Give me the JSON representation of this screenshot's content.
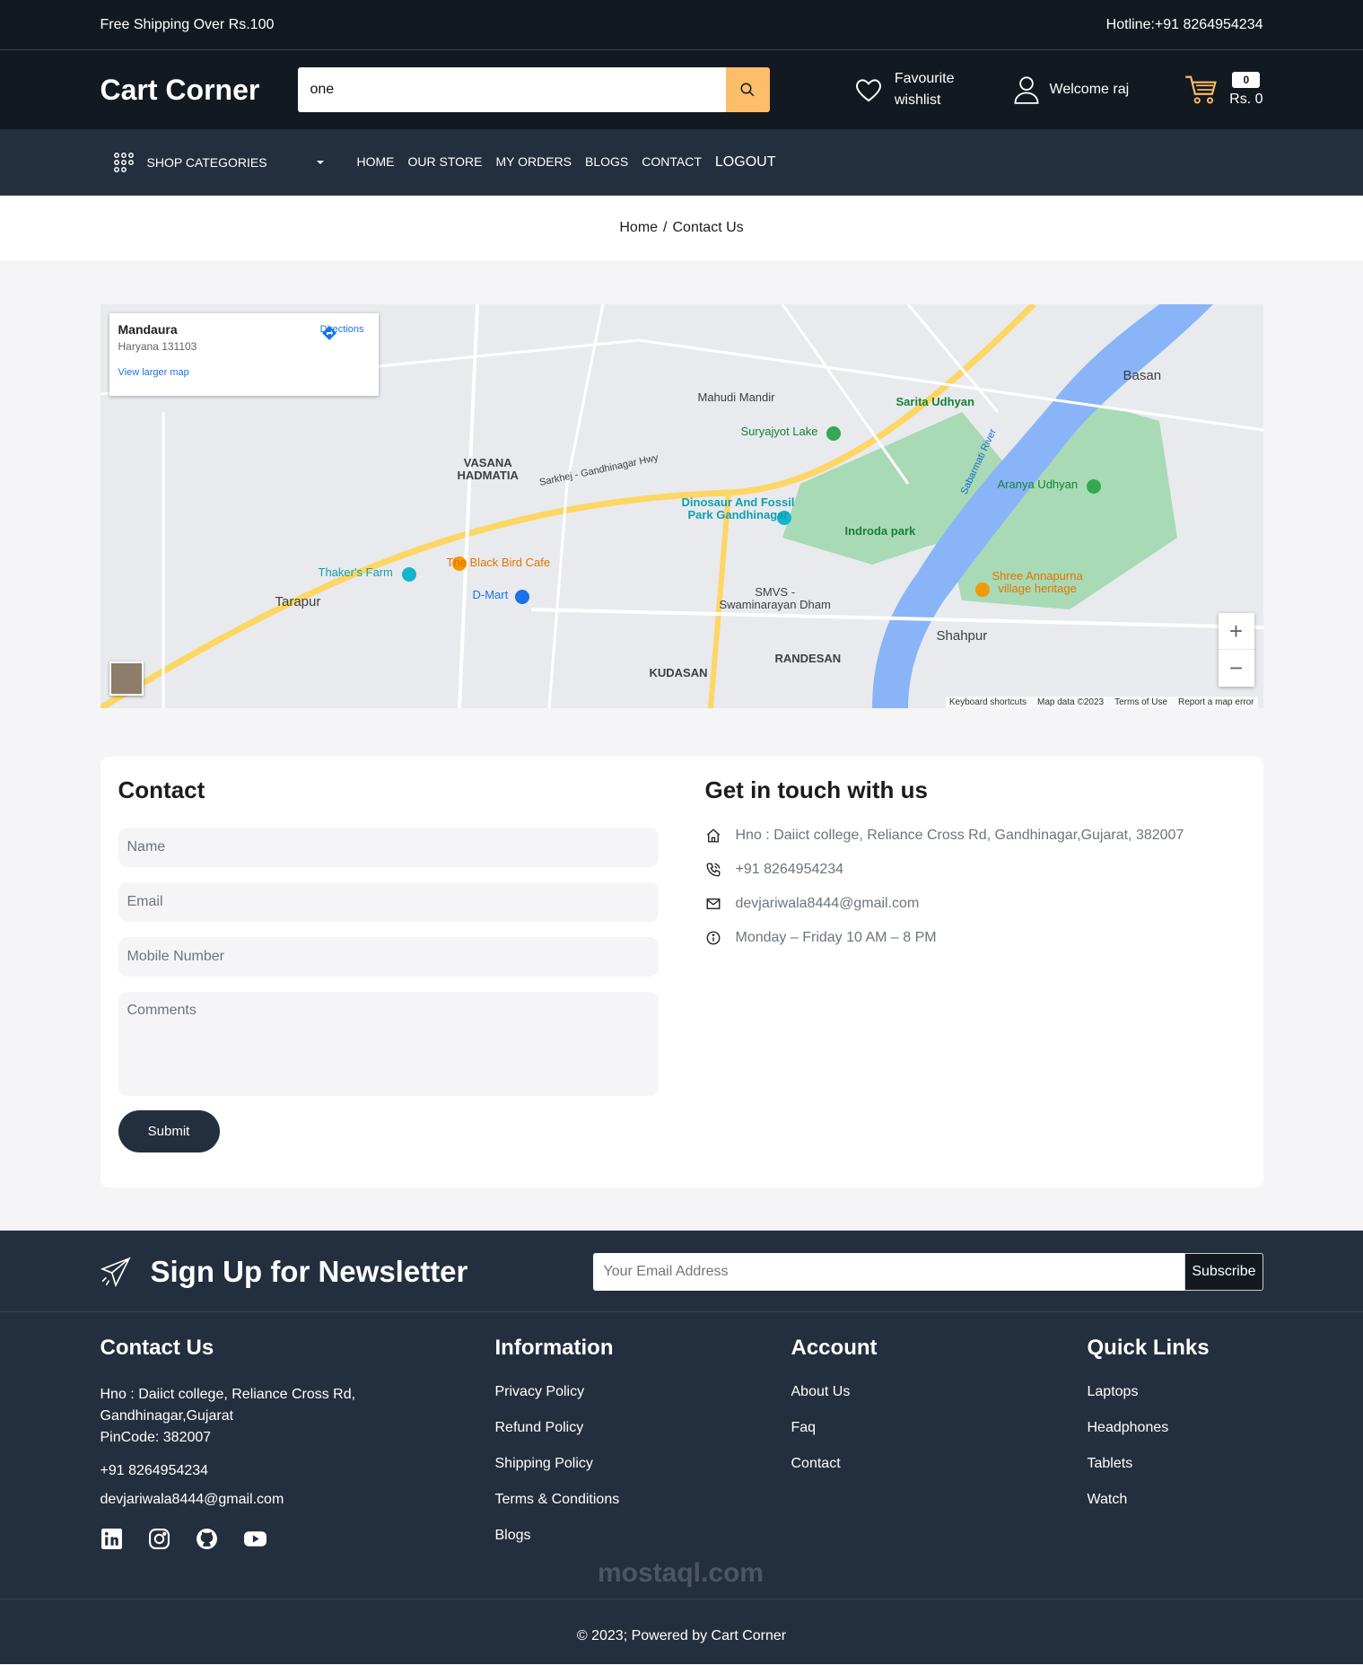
{
  "topbar": {
    "left": "Free Shipping Over Rs.100",
    "right": "Hotline:+91 8264954234"
  },
  "header": {
    "logo": "Cart Corner",
    "search_value": "one",
    "fav_line1": "Favourite",
    "fav_line2": "wishlist",
    "welcome": "Welcome raj",
    "cart_count": "0",
    "cart_total": "Rs. 0"
  },
  "nav": {
    "categories": "SHOP CATEGORIES",
    "items": [
      "HOME",
      "OUR STORE",
      "MY ORDERS",
      "BLOGS",
      "CONTACT"
    ],
    "logout": "LOGOUT"
  },
  "breadcrumb": {
    "home": "Home",
    "sep": "/",
    "current": "Contact Us"
  },
  "map": {
    "place": "Mandaura",
    "address": "Haryana 131103",
    "directions": "Directions",
    "larger": "View larger map",
    "zoom_in": "+",
    "zoom_out": "−",
    "attrib": [
      "Keyboard shortcuts",
      "Map data ©2023",
      "Terms of Use",
      "Report a map error"
    ],
    "labels": {
      "vasana": "VASANA\nHADMATIA",
      "tarapur": "Tarapur",
      "shahpur": "Shahpur",
      "basan": "Basan",
      "randesan": "RANDESAN",
      "kudasan": "KUDASAN",
      "dinosaur": "Dinosaur And Fossil\nPark Gandhinagar",
      "indroda": "Indroda park",
      "blackbird": "The Black Bird Cafe",
      "thaker": "Thaker's Farm",
      "dmart": "D-Mart",
      "mahudi": "Mahudi Mandir",
      "suryajyot": "Suryajyot Lake",
      "sarita": "Sarita Udhyan",
      "aranya": "Aranya Udhyan",
      "annapurna": "Shree Annapurna\nvillage heritage",
      "smvs": "SMVS -\nSwaminarayan Dham",
      "river": "Sabarmati River",
      "hwy": "Sarkhej - Gandhinagar Hwy"
    }
  },
  "contact": {
    "title": "Contact",
    "name_ph": "Name",
    "email_ph": "Email",
    "mobile_ph": "Mobile Number",
    "comments_ph": "Comments",
    "submit": "Submit"
  },
  "touch": {
    "title": "Get in touch with us",
    "address": "Hno : Daiict college, Reliance Cross Rd, Gandhinagar,Gujarat, 382007",
    "phone": "+91 8264954234",
    "email": "devjariwala8444@gmail.com",
    "hours": "Monday – Friday 10 AM – 8 PM"
  },
  "newsletter": {
    "title": "Sign Up for Newsletter",
    "placeholder": "Your Email Address",
    "button": "Subscribe"
  },
  "footer": {
    "contact": {
      "title": "Contact Us",
      "addr1": "Hno : Daiict college, Reliance Cross Rd,",
      "addr2": "Gandhinagar,Gujarat",
      "addr3": "PinCode: 382007",
      "phone": "+91 8264954234",
      "email": "devjariwala8444@gmail.com"
    },
    "information": {
      "title": "Information",
      "items": [
        "Privacy Policy",
        "Refund Policy",
        "Shipping Policy",
        "Terms & Conditions",
        "Blogs"
      ]
    },
    "account": {
      "title": "Account",
      "items": [
        "About Us",
        "Faq",
        "Contact"
      ]
    },
    "quick": {
      "title": "Quick Links",
      "items": [
        "Laptops",
        "Headphones",
        "Tablets",
        "Watch"
      ]
    }
  },
  "copyright": "© 2023; Powered by Cart Corner",
  "watermark": "mostaql.com",
  "colors": {
    "dark": "#131921",
    "nav": "#232f3e",
    "accent": "#febd69"
  }
}
